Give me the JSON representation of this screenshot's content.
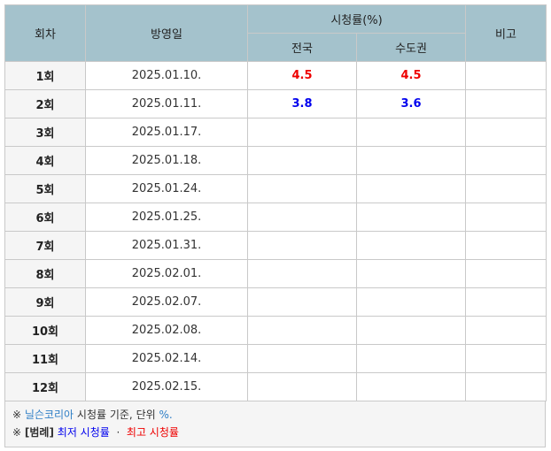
{
  "header": {
    "episode": "회차",
    "airdate": "방영일",
    "ratings": "시청률(%)",
    "nationwide": "전국",
    "capital": "수도권",
    "remarks": "비고"
  },
  "rows": [
    {
      "episode": "1회",
      "date": "2025.01.10.",
      "nationwide": "4.5",
      "capital": "4.5",
      "remarks": ""
    },
    {
      "episode": "2회",
      "date": "2025.01.11.",
      "nationwide": "3.8",
      "capital": "3.6",
      "remarks": ""
    },
    {
      "episode": "3회",
      "date": "2025.01.17.",
      "nationwide": "",
      "capital": "",
      "remarks": ""
    },
    {
      "episode": "4회",
      "date": "2025.01.18.",
      "nationwide": "",
      "capital": "",
      "remarks": ""
    },
    {
      "episode": "5회",
      "date": "2025.01.24.",
      "nationwide": "",
      "capital": "",
      "remarks": ""
    },
    {
      "episode": "6회",
      "date": "2025.01.25.",
      "nationwide": "",
      "capital": "",
      "remarks": ""
    },
    {
      "episode": "7회",
      "date": "2025.01.31.",
      "nationwide": "",
      "capital": "",
      "remarks": ""
    },
    {
      "episode": "8회",
      "date": "2025.02.01.",
      "nationwide": "",
      "capital": "",
      "remarks": ""
    },
    {
      "episode": "9회",
      "date": "2025.02.07.",
      "nationwide": "",
      "capital": "",
      "remarks": ""
    },
    {
      "episode": "10회",
      "date": "2025.02.08.",
      "nationwide": "",
      "capital": "",
      "remarks": ""
    },
    {
      "episode": "11회",
      "date": "2025.02.14.",
      "nationwide": "",
      "capital": "",
      "remarks": ""
    },
    {
      "episode": "12회",
      "date": "2025.02.15.",
      "nationwide": "",
      "capital": "",
      "remarks": ""
    }
  ],
  "notes": {
    "mark": "※",
    "line1_source": "닐슨코리아",
    "line1_rest": "시청률 기준, 단위",
    "line1_unit": "%.",
    "line2_label": "[범례]",
    "line2_low": "최저 시청률",
    "line2_sep": "·",
    "line2_high": "최고 시청률"
  },
  "colors": {
    "lowest": "#0000ee",
    "highest": "#ee0000",
    "header_bg": "#a4c2cc",
    "link": "#2f7fc6"
  }
}
